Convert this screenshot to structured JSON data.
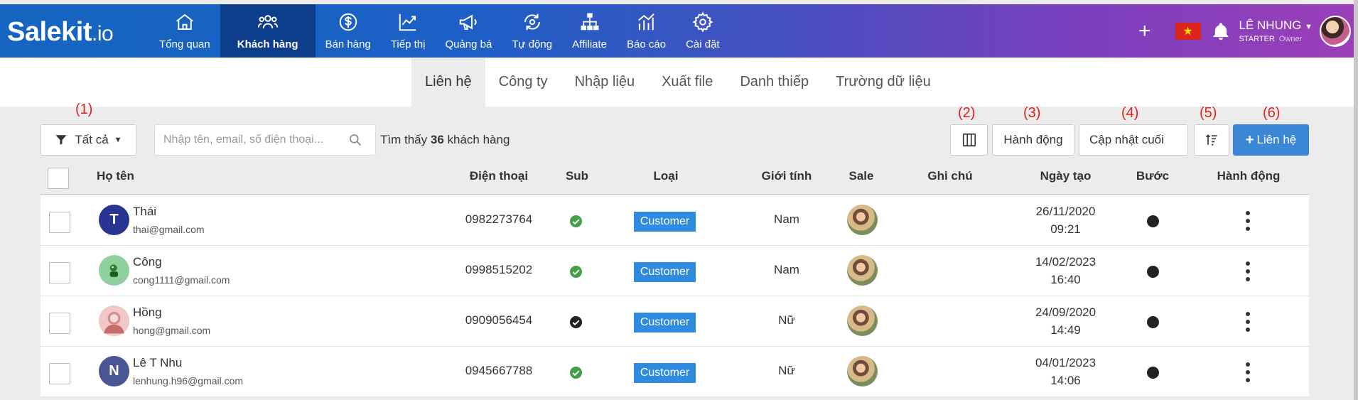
{
  "app": {
    "logo_main": "Salekit",
    "logo_suffix": ".io"
  },
  "nav": [
    {
      "label": "Tổng quan",
      "icon": "home-icon"
    },
    {
      "label": "Khách hàng",
      "icon": "users-icon",
      "active": true
    },
    {
      "label": "Bán hàng",
      "icon": "dollar-icon"
    },
    {
      "label": "Tiếp thị",
      "icon": "trend-icon"
    },
    {
      "label": "Quảng bá",
      "icon": "megaphone-icon"
    },
    {
      "label": "Tự động",
      "icon": "automation-icon"
    },
    {
      "label": "Affiliate",
      "icon": "network-icon"
    },
    {
      "label": "Báo cáo",
      "icon": "report-icon"
    },
    {
      "label": "Cài đặt",
      "icon": "gear-icon"
    }
  ],
  "user": {
    "name": "LÊ NHUNG",
    "plan": "STARTER",
    "role": "Owner"
  },
  "subtabs": [
    "Liên hệ",
    "Công ty",
    "Nhập liệu",
    "Xuất file",
    "Danh thiếp",
    "Trường dữ liệu"
  ],
  "annotations": [
    "(1)",
    "(2)",
    "(3)",
    "(4)",
    "(5)",
    "(6)"
  ],
  "toolbar": {
    "filter_label": "Tất cả",
    "search_placeholder": "Nhập tên, email, số điện thoại...",
    "found_prefix": "Tìm thấy",
    "found_count": "36",
    "found_suffix": "khách hàng",
    "action_label": "Hành động",
    "sort_field": "Cập nhật cuối",
    "add_label": "Liên hệ"
  },
  "table": {
    "headers": {
      "name": "Họ tên",
      "phone": "Điện thoại",
      "sub": "Sub",
      "type": "Loại",
      "gender": "Giới tính",
      "sale": "Sale",
      "note": "Ghi chú",
      "created": "Ngày tạo",
      "step": "Bước",
      "action": "Hành động"
    },
    "rows": [
      {
        "initial": "T",
        "avatar_color": "#283593",
        "name": "Thái",
        "email": "thai@gmail.com",
        "phone": "0982273764",
        "sub": "green",
        "type": "Customer",
        "gender": "Nam",
        "date": "26/11/2020",
        "time": "09:21"
      },
      {
        "initial": "",
        "avatar_color": "#8fd19e",
        "name": "Công",
        "email": "cong1111@gmail.com",
        "phone": "0998515202",
        "sub": "green",
        "type": "Customer",
        "gender": "Nam",
        "date": "14/02/2023",
        "time": "16:40"
      },
      {
        "initial": "",
        "avatar_color": "#e8b5b5",
        "name": "Hồng",
        "email": "hong@gmail.com",
        "phone": "0909056454",
        "sub": "black",
        "type": "Customer",
        "gender": "Nữ",
        "date": "24/09/2020",
        "time": "14:49"
      },
      {
        "initial": "N",
        "avatar_color": "#4a5596",
        "name": "Lê T Nhu",
        "email": "lenhung.h96@gmail.com",
        "phone": "0945667788",
        "sub": "green",
        "type": "Customer",
        "gender": "Nữ",
        "date": "04/01/2023",
        "time": "14:06"
      }
    ]
  },
  "colors": {
    "accent": "#3b87d6",
    "badge": "#2e8bdf",
    "annotation": "#e02020",
    "sub_ok": "#43a047"
  }
}
